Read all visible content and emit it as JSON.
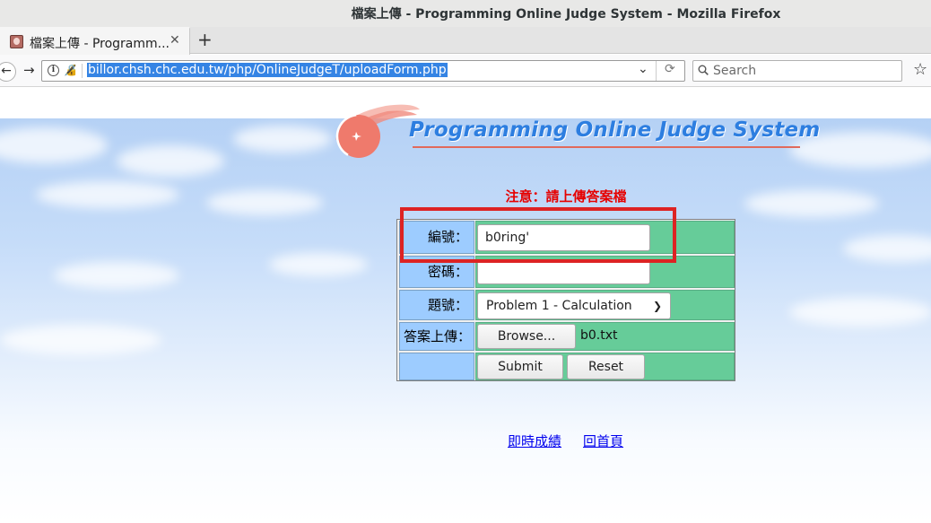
{
  "window": {
    "title": "檔案上傳 - Programming Online Judge System - Mozilla Firefox"
  },
  "tab": {
    "title": "檔案上傳 - Programm...",
    "favicon": "tux-favicon-icon"
  },
  "navbar": {
    "url": "billor.chsh.chc.edu.tw/php/OnlineJudgeT/uploadForm.php",
    "search_placeholder": "Search"
  },
  "page": {
    "logo_text": "Programming Online Judge System",
    "notice": "注意：請上傳答案檔",
    "form": {
      "id_label": "編號：",
      "id_value": "b0ring'",
      "password_label": "密碼：",
      "password_value": "",
      "problem_label": "題號：",
      "problem_selected": "Problem 1 - Calculation",
      "upload_label": "答案上傳：",
      "browse_label": "Browse...",
      "file_name": "b0.txt",
      "submit_label": "Submit",
      "reset_label": "Reset"
    },
    "links": {
      "scores": "即時成績",
      "home": "回首頁"
    }
  },
  "colors": {
    "label_cell": "#9dccff",
    "field_cell": "#66cc99",
    "notice": "#e60000",
    "highlight_box": "#dd2323",
    "logo_text": "#2d7ee0"
  }
}
